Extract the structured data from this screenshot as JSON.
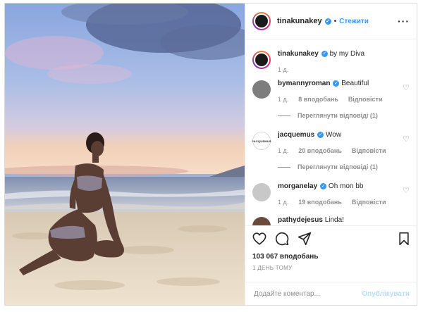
{
  "header": {
    "username": "tinakunakey",
    "separator": "•",
    "follow_label": "Стежити",
    "more_label": "···"
  },
  "caption": {
    "username": "tinakunakey",
    "text": "by my Diva",
    "time": "1 д."
  },
  "comments": [
    {
      "username": "bymannyroman",
      "text": "Beautiful",
      "time": "1 д.",
      "likes": "8 вподобань",
      "reply_label": "Відповісти",
      "view_replies": "Переглянути відповіді (1)"
    },
    {
      "username": "jacquemus",
      "text": "Wow",
      "time": "1 д.",
      "likes": "20 вподобань",
      "reply_label": "Відповісти",
      "view_replies": "Переглянути відповіді (1)",
      "avatar_text": "JACQUEMUS"
    },
    {
      "username": "morganelay",
      "text": "Oh mon bb",
      "time": "1 д.",
      "likes": "19 вподобань",
      "reply_label": "Відповісти"
    },
    {
      "username": "pathydejesus",
      "text": "Linda!"
    }
  ],
  "actions": {
    "likes_count": "103 067 вподобань",
    "posted_ago": "1 ДЕНЬ ТОМУ"
  },
  "add_comment": {
    "placeholder": "Додайте коментар...",
    "post_label": "Опублікувати"
  },
  "colors": {
    "link": "#3897f0",
    "muted": "#8e8e8e",
    "border": "#dbdbdb",
    "post_disabled": "#b2dffc"
  }
}
